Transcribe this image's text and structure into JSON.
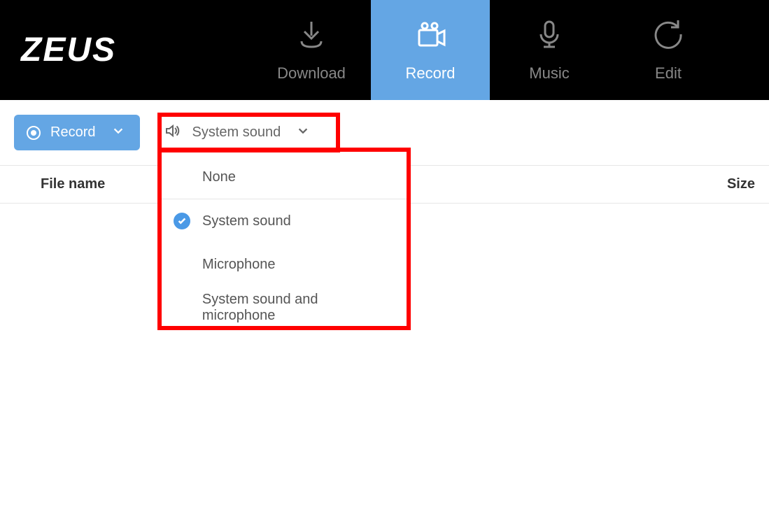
{
  "app": {
    "name": "ZEUS"
  },
  "tabs": [
    {
      "key": "download",
      "label": "Download",
      "active": false
    },
    {
      "key": "record",
      "label": "Record",
      "active": true
    },
    {
      "key": "music",
      "label": "Music",
      "active": false
    },
    {
      "key": "edit",
      "label": "Edit",
      "active": false
    }
  ],
  "toolbar": {
    "record_label": "Record",
    "sound_selector": {
      "selected": "System sound",
      "options": [
        {
          "label": "None",
          "selected": false
        },
        {
          "label": "System sound",
          "selected": true
        },
        {
          "label": "Microphone",
          "selected": false
        },
        {
          "label": "System sound and microphone",
          "selected": false
        }
      ]
    }
  },
  "table": {
    "columns": {
      "filename": "File name",
      "size": "Size"
    },
    "rows": []
  },
  "highlight_color": "#ff0000",
  "accent_color": "#64a6e4"
}
